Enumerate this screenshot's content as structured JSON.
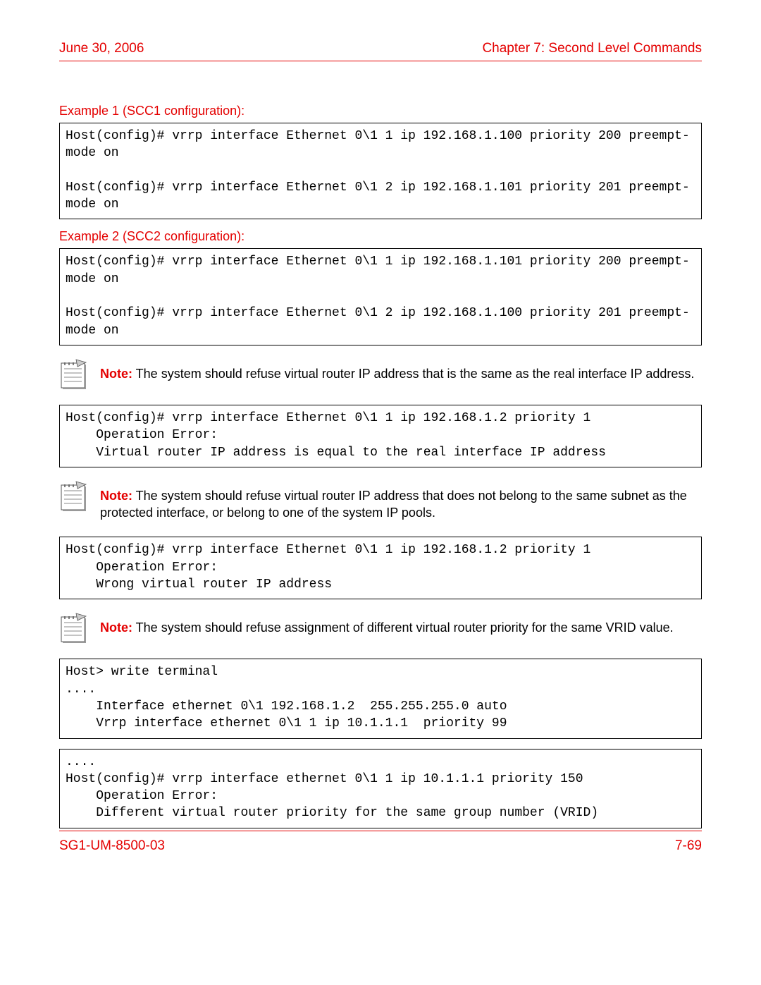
{
  "header": {
    "date": "June 30, 2006",
    "chapter": "Chapter 7: Second Level Commands"
  },
  "example1_label": "Example 1 (SCC1 configuration):",
  "code1": "Host(config)# vrrp interface Ethernet 0\\1 1 ip 192.168.1.100 priority 200 preempt-mode on\n\nHost(config)# vrrp interface Ethernet 0\\1 2 ip 192.168.1.101 priority 201 preempt-mode on",
  "example2_label": "Example 2 (SCC2 configuration):",
  "code2": "Host(config)# vrrp interface Ethernet 0\\1 1 ip 192.168.1.101 priority 200 preempt-mode on\n\nHost(config)# vrrp interface Ethernet 0\\1 2 ip 192.168.1.100 priority 201 preempt-mode on",
  "note_label": "Note:",
  "note1_text": " The system should refuse virtual router IP address that is the same as the real interface IP address.",
  "code3": "Host(config)# vrrp interface Ethernet 0\\1 1 ip 192.168.1.2 priority 1\n    Operation Error:\n    Virtual router IP address is equal to the real interface IP address",
  "note2_text": " The system should refuse virtual router IP address that does not belong to the same subnet as the protected interface, or belong to one of the system IP pools.",
  "code4": "Host(config)# vrrp interface Ethernet 0\\1 1 ip 192.168.1.2 priority 1\n    Operation Error:\n    Wrong virtual router IP address",
  "note3_text": " The system should refuse assignment of different virtual router priority for the same VRID value.",
  "code5": "Host> write terminal\n....\n    Interface ethernet 0\\1 192.168.1.2  255.255.255.0 auto\n    Vrrp interface ethernet 0\\1 1 ip 10.1.1.1  priority 99",
  "code6": "....\nHost(config)# vrrp interface ethernet 0\\1 1 ip 10.1.1.1 priority 150\n    Operation Error:\n    Different virtual router priority for the same group number (VRID)",
  "footer": {
    "doc_id": "SG1-UM-8500-03",
    "page_num": "7-69"
  }
}
